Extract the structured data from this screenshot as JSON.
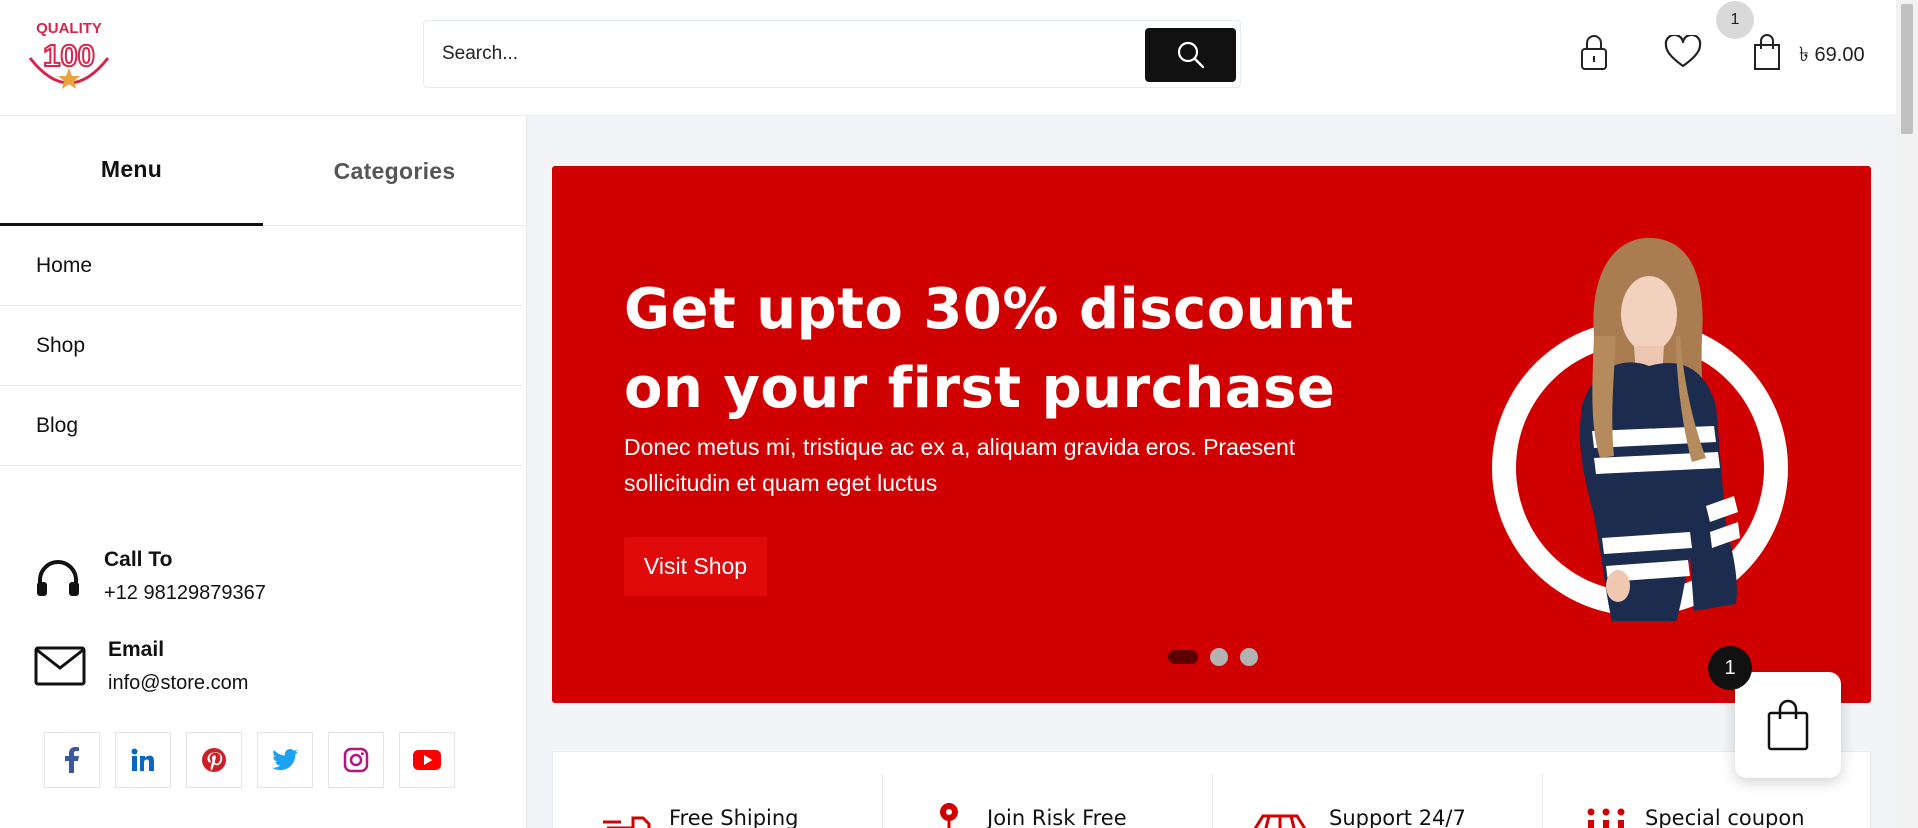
{
  "header": {
    "logo_text": "QUALITY 100",
    "search_placeholder": "Search...",
    "wishlist_count": "1",
    "cart_total": "৳ 69.00",
    "icons": [
      "search-icon",
      "lock-icon",
      "heart-icon",
      "shopping-bag-icon"
    ]
  },
  "sidebar": {
    "tabs": [
      {
        "label": "Menu",
        "active": true
      },
      {
        "label": "Categories",
        "active": false
      }
    ],
    "menu_items": [
      {
        "label": "Home"
      },
      {
        "label": "Shop"
      },
      {
        "label": "Blog"
      }
    ],
    "contact": {
      "call_title": "Call To",
      "call_value": "+12 98129879367",
      "email_title": "Email",
      "email_value": "info@store.com"
    },
    "socials": [
      {
        "name": "facebook",
        "color": "#3b5998"
      },
      {
        "name": "linkedin",
        "color": "#0a66c2"
      },
      {
        "name": "pinterest",
        "color": "#cb2027"
      },
      {
        "name": "twitter",
        "color": "#1da1f2"
      },
      {
        "name": "instagram",
        "color": "#b5167e"
      },
      {
        "name": "youtube",
        "color": "#ff0000"
      }
    ]
  },
  "hero": {
    "title": "Get upto 30% discount on your first purchase",
    "description": "Donec metus mi, tristique ac ex a, aliquam gravida eros. Praesent sollicitudin et quam eget luctus",
    "button_label": "Visit Shop",
    "background_color": "#d10000",
    "slides_count": 3,
    "active_slide": 1
  },
  "floating_cart": {
    "count": "1"
  },
  "features": [
    {
      "label": "Free Shiping",
      "icon": "truck-icon"
    },
    {
      "label": "Join Risk Free",
      "icon": "location-pin-icon"
    },
    {
      "label": "Support 24/7",
      "icon": "support-icon"
    },
    {
      "label": "Special coupon",
      "icon": "coupon-icon"
    }
  ],
  "colors": {
    "accent": "#d10000",
    "dark": "#111111",
    "button_red": "#e00a0a"
  }
}
